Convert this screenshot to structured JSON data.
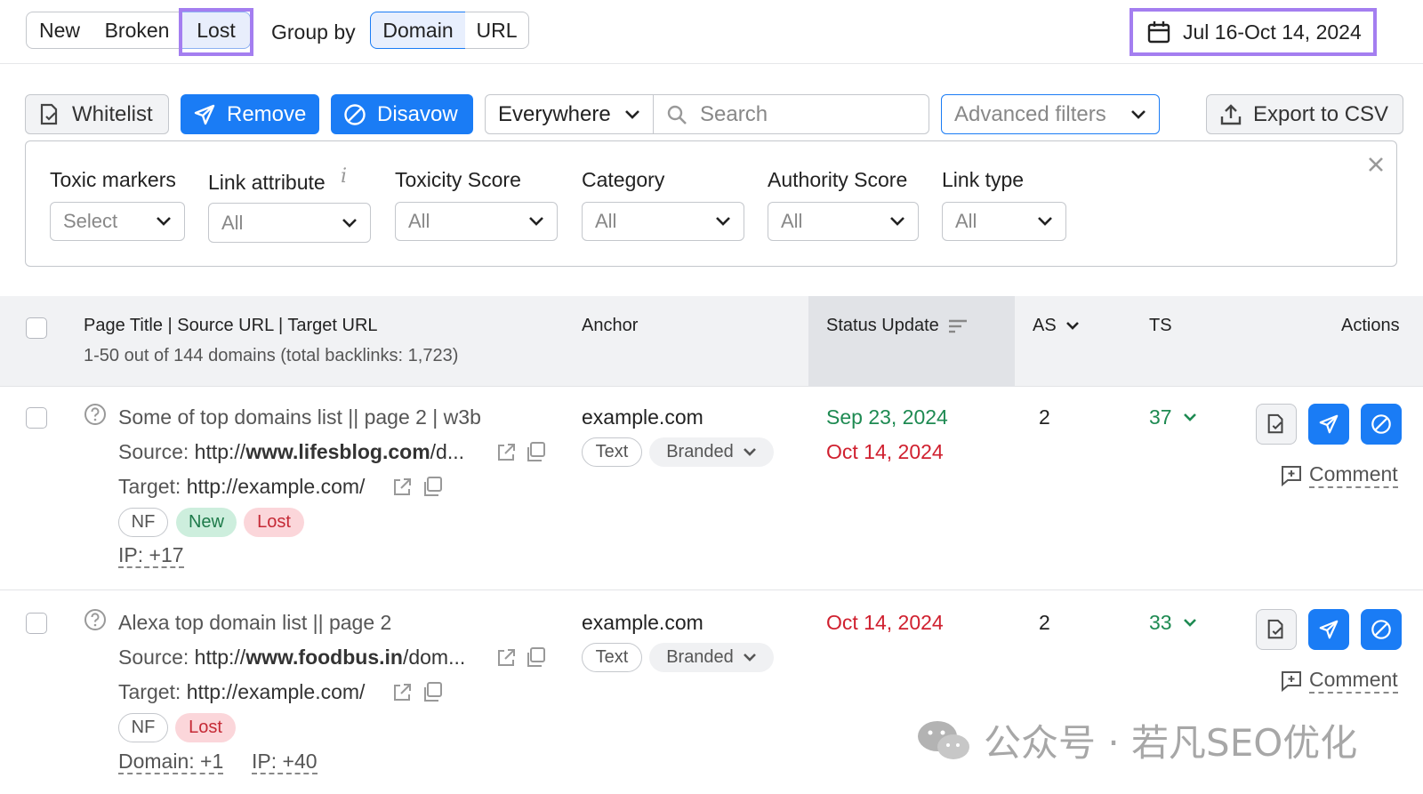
{
  "tabs": {
    "status": [
      "New",
      "Broken",
      "Lost"
    ],
    "active_status": "Lost",
    "group_by_label": "Group by",
    "group_by": [
      "Domain",
      "URL"
    ],
    "active_group_by": "Domain"
  },
  "date_range": "Jul 16-Oct 14, 2024",
  "toolbar": {
    "whitelist": "Whitelist",
    "remove": "Remove",
    "disavow": "Disavow",
    "scope": "Everywhere",
    "search_placeholder": "Search",
    "advanced_filters": "Advanced filters",
    "export": "Export to CSV"
  },
  "filters": [
    {
      "label": "Toxic markers",
      "value": "Select"
    },
    {
      "label": "Link attribute",
      "value": "All"
    },
    {
      "label": "Toxicity Score",
      "value": "All"
    },
    {
      "label": "Category",
      "value": "All"
    },
    {
      "label": "Authority Score",
      "value": "All"
    },
    {
      "label": "Link type",
      "value": "All"
    }
  ],
  "filter_info_glyph": "i",
  "table": {
    "headers": {
      "page": "Page Title | Source URL | Target URL",
      "summary": "1-50 out of 144 domains (total backlinks: 1,723)",
      "anchor": "Anchor",
      "status": "Status Update",
      "as": "AS",
      "ts": "TS",
      "actions": "Actions"
    },
    "rows": [
      {
        "title": "Some of top domains list || page 2 | w3b",
        "source_prefix": "Source: ",
        "source_url_start": "http://",
        "source_url_bold": "www.lifesblog.com",
        "source_url_end": "/d...",
        "target_prefix": "Target: ",
        "target_url": "http://example.com/",
        "tags": [
          "NF",
          "New",
          "Lost"
        ],
        "meta": [
          "IP: +17"
        ],
        "anchor": "example.com",
        "anchor_type": "Text",
        "anchor_category": "Branded",
        "status_dates": [
          {
            "date": "Sep 23, 2024",
            "state": "new"
          },
          {
            "date": "Oct 14, 2024",
            "state": "lost"
          }
        ],
        "as": "2",
        "ts": "37",
        "comment": "Comment"
      },
      {
        "title": "Alexa top domain list || page 2",
        "source_prefix": "Source: ",
        "source_url_start": "http://",
        "source_url_bold": "www.foodbus.in",
        "source_url_end": "/dom...",
        "target_prefix": "Target: ",
        "target_url": "http://example.com/",
        "tags": [
          "NF",
          "Lost"
        ],
        "meta": [
          "Domain: +1",
          "IP: +40"
        ],
        "anchor": "example.com",
        "anchor_type": "Text",
        "anchor_category": "Branded",
        "status_dates": [
          {
            "date": "Oct 14, 2024",
            "state": "lost"
          }
        ],
        "as": "2",
        "ts": "33",
        "comment": "Comment"
      }
    ]
  },
  "watermark": "公众号 · 若凡SEO优化",
  "colors": {
    "accent_blue": "#1a7cf5",
    "highlight_purple": "#a47ef0",
    "new_green": "#1e8a52",
    "lost_red": "#d0202f"
  },
  "icons": [
    "calendar-icon",
    "whitelist-icon",
    "send-icon",
    "disavow-icon",
    "chevron-down-icon",
    "search-icon",
    "export-icon",
    "close-icon",
    "help-circle-icon",
    "external-link-icon",
    "copy-icon",
    "comment-icon",
    "sort-icon",
    "wechat-icon"
  ]
}
